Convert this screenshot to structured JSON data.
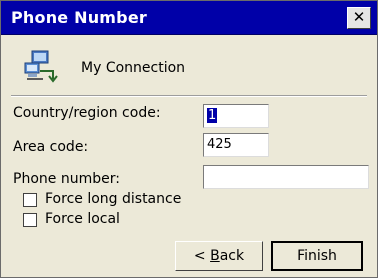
{
  "window": {
    "title": "Phone Number",
    "close_glyph": "✕",
    "colors": {
      "titlebar": "#0000a8",
      "body": "#ece9d8"
    }
  },
  "connection": {
    "icon": "network-connection-icon",
    "name": "My Connection"
  },
  "form": {
    "country_code": {
      "label": "Country/region code:",
      "value": "1",
      "selected": true
    },
    "area_code": {
      "label": "Area code:",
      "value": "425"
    },
    "phone_number": {
      "label": "Phone number:",
      "value": ""
    },
    "force_long_distance": {
      "label": "Force long distance",
      "checked": false
    },
    "force_local": {
      "label": "Force local",
      "checked": false
    }
  },
  "buttons": {
    "back": {
      "prefix": "< ",
      "accel": "B",
      "rest": "ack"
    },
    "finish": {
      "label": "Finish"
    }
  }
}
